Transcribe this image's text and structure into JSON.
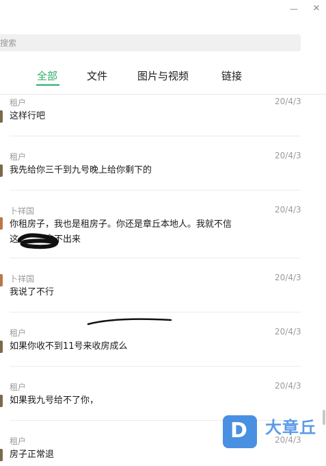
{
  "window": {
    "minimize_icon": "minimize-icon",
    "close_icon": "close-icon",
    "minimize_glyph": "—",
    "close_glyph": "✕"
  },
  "search": {
    "placeholder": "搜索"
  },
  "tabs": [
    {
      "label": "全部",
      "active": true
    },
    {
      "label": "文件",
      "active": false
    },
    {
      "label": "图片与视频",
      "active": false
    },
    {
      "label": "链接",
      "active": false
    }
  ],
  "messages": [
    {
      "sender": "租户",
      "date": "20/4/3",
      "lines": [
        "这样行吧"
      ]
    },
    {
      "sender": "租户",
      "date": "20/4/3",
      "lines": [
        "我先给你三千到九号晚上给你剩下的"
      ]
    },
    {
      "sender": "卜祥国",
      "date": "20/4/3",
      "lines": [
        "你租房子，我也是租房子。你还是章丘本地人。我就不信",
        "这　　　拿不出来"
      ]
    },
    {
      "sender": "卜祥国",
      "date": "20/4/3",
      "lines": [
        "我说了不行"
      ]
    },
    {
      "sender": "租户",
      "date": "20/4/3",
      "lines": [
        "如果你收不到11号来收房成么"
      ]
    },
    {
      "sender": "租户",
      "date": "20/4/3",
      "lines": [
        "如果我九号给不了你，"
      ]
    },
    {
      "sender": "租户",
      "date": "20/4/3",
      "lines": [
        "房子正常退"
      ]
    }
  ],
  "watermark": {
    "text": "大章丘",
    "badge_letter": "D"
  },
  "colors": {
    "accent": "#2aae67",
    "muted": "#9a9a9a",
    "logo": "#4a90e2"
  }
}
